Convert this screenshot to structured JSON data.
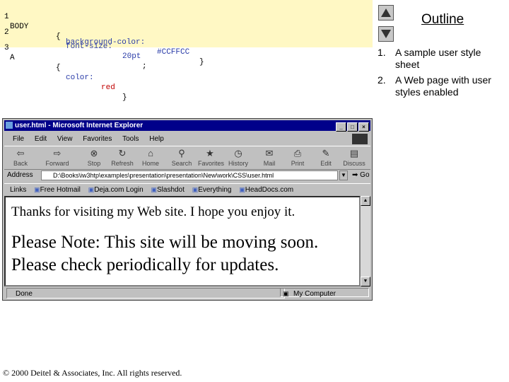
{
  "code": {
    "lines": [
      {
        "num": "1",
        "selector": "BODY",
        "open": "{",
        "prop": "font-size:",
        "value": "20pt",
        "tail": ";"
      },
      {
        "num": "2",
        "prop": "background-color:",
        "value": "#CCFFCC",
        "tail": "}"
      },
      {
        "num": "3",
        "selector": "A",
        "open": "{",
        "prop": "color:",
        "value": "red",
        "tail": "}"
      }
    ]
  },
  "outline": {
    "title": "Outline",
    "items": [
      {
        "num": "1.",
        "text": "A sample user style sheet"
      },
      {
        "num": "2.",
        "text": "A Web page with user styles enabled"
      }
    ]
  },
  "browser": {
    "title": "user.html - Microsoft Internet Explorer",
    "window_buttons": [
      "_",
      "□",
      "×"
    ],
    "menu": [
      "File",
      "Edit",
      "View",
      "Favorites",
      "Tools",
      "Help"
    ],
    "toolbar": [
      {
        "label": "Back",
        "icon": "back-arrow-icon"
      },
      {
        "label": "Forward",
        "icon": "forward-arrow-icon"
      },
      {
        "label": "Stop",
        "icon": "stop-icon"
      },
      {
        "label": "Refresh",
        "icon": "refresh-icon"
      },
      {
        "label": "Home",
        "icon": "home-icon"
      },
      {
        "label": "Search",
        "icon": "search-icon"
      },
      {
        "label": "Favorites",
        "icon": "favorites-icon"
      },
      {
        "label": "History",
        "icon": "history-icon"
      },
      {
        "label": "Mail",
        "icon": "mail-icon"
      },
      {
        "label": "Print",
        "icon": "print-icon"
      },
      {
        "label": "Edit",
        "icon": "edit-icon"
      },
      {
        "label": "Discuss",
        "icon": "discuss-icon"
      }
    ],
    "address_label": "Address",
    "address_value": "D:\\Books\\iw3htp\\examples\\presentation\\presentation\\New\\work\\CSS\\user.html",
    "go_label": "Go",
    "links_label": "Links",
    "links": [
      "Free Hotmail",
      "Deja.com Login",
      "Slashdot",
      "Everything",
      "HeadDocs.com"
    ],
    "content_line1": "Thanks for visiting my Web site. I hope you enjoy it.",
    "content_line2": "Please Note: This site will be moving soon.",
    "content_line3": "Please check periodically for updates.",
    "status_text": "Done",
    "status_zone": "My Computer"
  },
  "footer": "© 2000 Deitel & Associates, Inc.  All rights reserved."
}
